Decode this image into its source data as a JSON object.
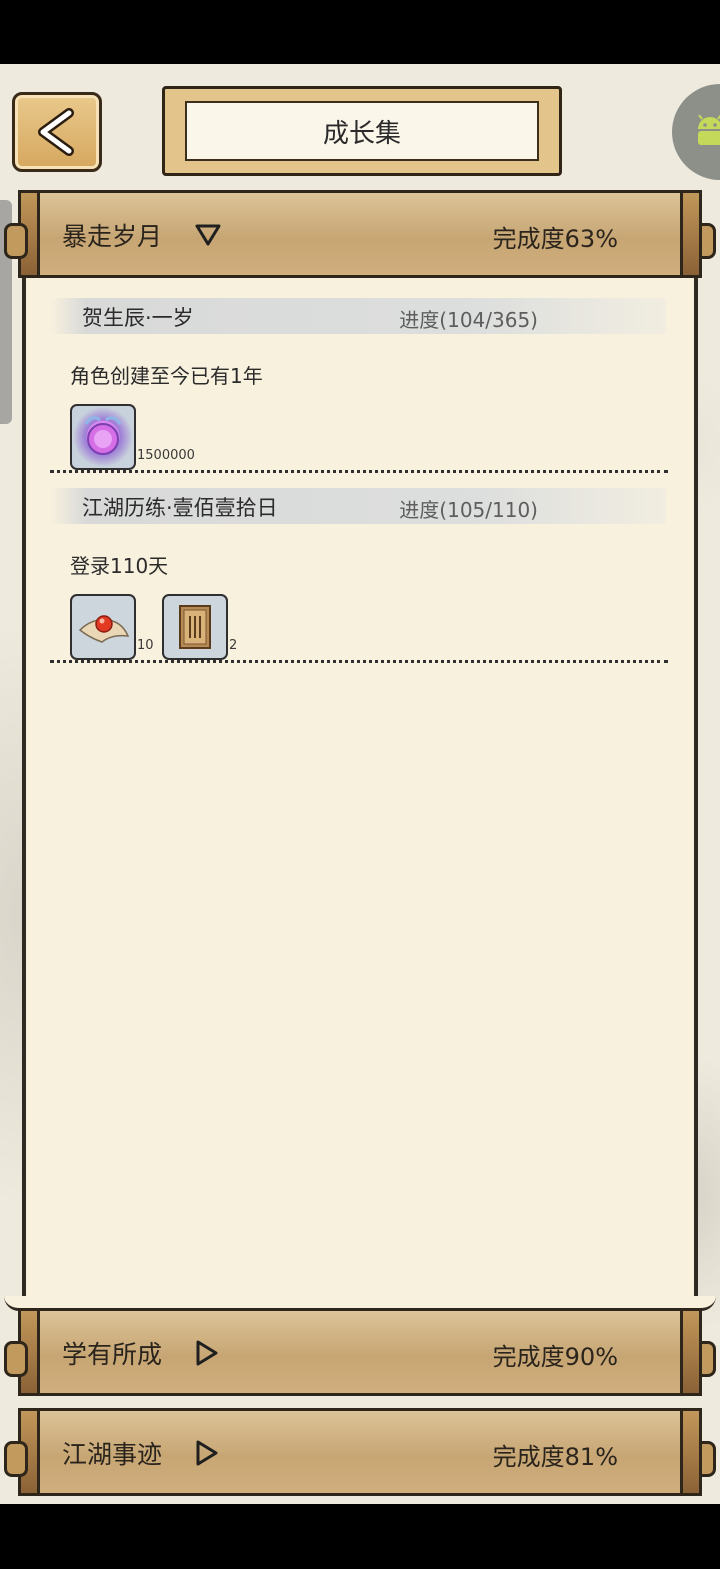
{
  "header": {
    "title": "成长集"
  },
  "categories": [
    {
      "name": "暴走岁月",
      "progress": "完成度63%",
      "expanded": true
    },
    {
      "name": "学有所成",
      "progress": "完成度90%",
      "expanded": false
    },
    {
      "name": "江湖事迹",
      "progress": "完成度81%",
      "expanded": false
    }
  ],
  "quests": [
    {
      "title": "贺生辰·一岁",
      "progress": "进度(104/365)",
      "desc": "角色创建至今已有1年",
      "rewards": [
        {
          "icon": "purple-orb-icon",
          "count": "1500000"
        }
      ]
    },
    {
      "title": "江湖历练·壹佰壹拾日",
      "progress": "进度(105/110)",
      "desc": "登录110天",
      "rewards": [
        {
          "icon": "red-pill-icon",
          "count": "10"
        },
        {
          "icon": "book-icon",
          "count": "2"
        }
      ]
    }
  ]
}
